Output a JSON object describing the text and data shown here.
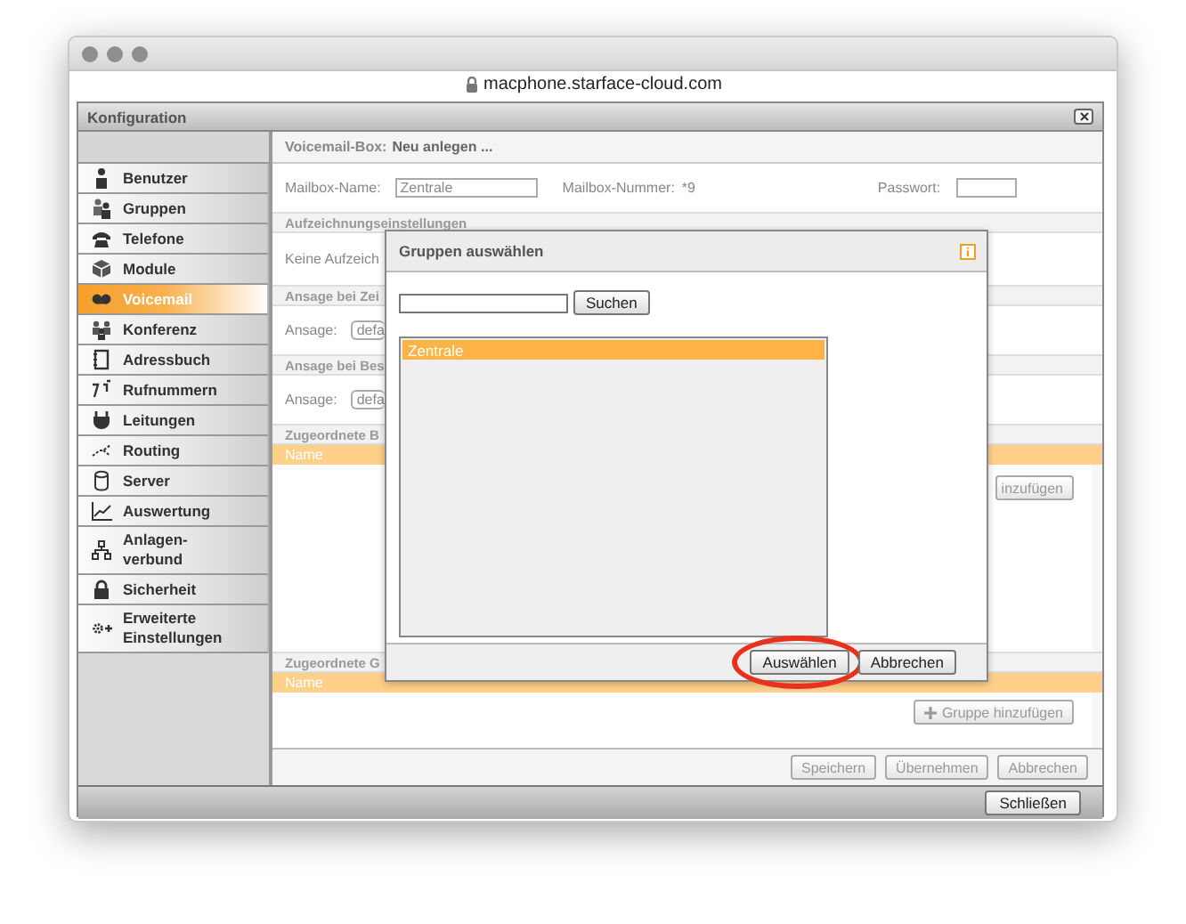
{
  "browser": {
    "url": "macphone.starface-cloud.com"
  },
  "panel": {
    "title": "Konfiguration"
  },
  "sidebar": {
    "items": [
      {
        "label": "Benutzer",
        "selected": false
      },
      {
        "label": "Gruppen",
        "selected": false
      },
      {
        "label": "Telefone",
        "selected": false
      },
      {
        "label": "Module",
        "selected": false
      },
      {
        "label": "Voicemail",
        "selected": true
      },
      {
        "label": "Konferenz",
        "selected": false
      },
      {
        "label": "Adressbuch",
        "selected": false
      },
      {
        "label": "Rufnummern",
        "selected": false
      },
      {
        "label": "Leitungen",
        "selected": false
      },
      {
        "label": "Routing",
        "selected": false
      },
      {
        "label": "Server",
        "selected": false
      },
      {
        "label": "Auswertung",
        "selected": false
      },
      {
        "label": "Anlagen-\nverbund",
        "selected": false
      },
      {
        "label": "Sicherheit",
        "selected": false
      },
      {
        "label": "Erweiterte\nEinstellungen",
        "selected": false
      }
    ]
  },
  "form": {
    "title_label": "Voicemail-Box:",
    "title_value": "Neu anlegen ...",
    "mailbox_name": {
      "label": "Mailbox-Name:",
      "value": "Zentrale"
    },
    "mailbox_number": {
      "label": "Mailbox-Nummer:",
      "value": "*9"
    },
    "password": {
      "label": "Passwort:"
    },
    "recording": {
      "heading": "Aufzeichnungseinstellungen",
      "text": "Keine Aufzeich"
    },
    "announcements": [
      {
        "heading": "Ansage bei Zei",
        "label": "Ansage:",
        "value": "defa"
      },
      {
        "heading": "Ansage bei Bes",
        "label": "Ansage:",
        "value": "defa"
      }
    ],
    "assignments": [
      {
        "heading": "Zugeordnete B",
        "column": "Name",
        "button": "inzufügen",
        "button_disabled": true,
        "kind": "text"
      },
      {
        "heading": "Zugeordnete G",
        "column": "Name",
        "button": "Gruppe hinzufügen",
        "button_disabled": true,
        "kind": "plus"
      }
    ],
    "actions": [
      {
        "label": "Speichern",
        "disabled": true
      },
      {
        "label": "Übernehmen",
        "disabled": true
      },
      {
        "label": "Abbrechen",
        "disabled": true
      }
    ]
  },
  "footer": {
    "button": "Schließen"
  },
  "dialog": {
    "title": "Gruppen auswählen",
    "search_button": "Suchen",
    "list": [
      {
        "label": "Zentrale",
        "selected": true
      }
    ],
    "buttons": [
      {
        "label": "Auswählen",
        "highlighted": true
      },
      {
        "label": "Abbrechen",
        "highlighted": false
      }
    ]
  }
}
